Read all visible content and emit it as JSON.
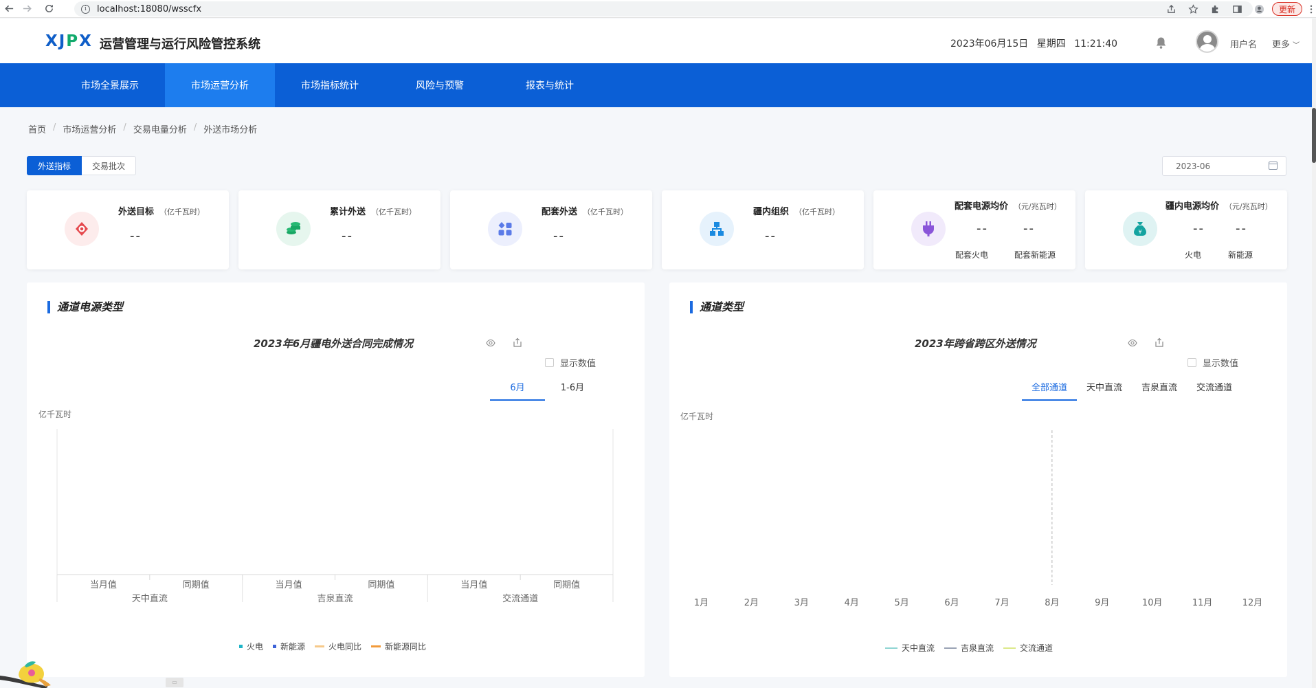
{
  "browser": {
    "url": "localhost:18080/wsscfx",
    "update_label": "更新"
  },
  "header": {
    "logo": "XJPX",
    "system_title": "运营管理与运行风险管控系统",
    "date": "2023年06月15日",
    "weekday": "星期四",
    "time": "11:21:40",
    "username": "用户名",
    "more": "更多"
  },
  "nav": {
    "items": [
      {
        "label": "市场全景展示",
        "active": false
      },
      {
        "label": "市场运营分析",
        "active": true
      },
      {
        "label": "市场指标统计",
        "active": false
      },
      {
        "label": "风险与预警",
        "active": false
      },
      {
        "label": "报表与统计",
        "active": false
      }
    ]
  },
  "breadcrumb": [
    "首页",
    "市场运营分析",
    "交易电量分析",
    "外送市场分析"
  ],
  "tabs": [
    {
      "label": "外送指标",
      "active": true
    },
    {
      "label": "交易批次",
      "active": false
    }
  ],
  "date_picker": {
    "value": "2023-06"
  },
  "kpis": [
    {
      "title": "外送目标",
      "unit": "（亿千瓦时）",
      "value": "--",
      "icon": "target-icon",
      "color": "#e5484d",
      "bg": "#fdecec"
    },
    {
      "title": "累计外送",
      "unit": "（亿千瓦时）",
      "value": "--",
      "icon": "coins-icon",
      "color": "#19a764",
      "bg": "#e6f6ee"
    },
    {
      "title": "配套外送",
      "unit": "（亿千瓦时）",
      "value": "--",
      "icon": "grid-icon",
      "color": "#5b7be8",
      "bg": "#eceffd"
    },
    {
      "title": "疆内组织",
      "unit": "（亿千瓦时）",
      "value": "--",
      "icon": "hierarchy-icon",
      "color": "#1a8ae0",
      "bg": "#e6f2fc"
    },
    {
      "title": "配套电源均价",
      "unit": "（元/兆瓦时）",
      "values": [
        "--",
        "--"
      ],
      "subs": [
        "配套火电",
        "配套新能源"
      ],
      "icon": "plug-icon",
      "color": "#8a55d9",
      "bg": "#f1eafb"
    },
    {
      "title": "疆内电源均价",
      "unit": "（元/兆瓦时）",
      "values": [
        "--",
        "--"
      ],
      "subs": [
        "火电",
        "新能源"
      ],
      "icon": "money-bag-icon",
      "color": "#14a3a0",
      "bg": "#dff3f3"
    }
  ],
  "left_panel": {
    "title": "通道电源类型",
    "chart_title": "2023年6月疆电外送合同完成情况",
    "show_values": "显示数值",
    "tabs": [
      {
        "label": "6月",
        "active": true
      },
      {
        "label": "1-6月",
        "active": false
      }
    ],
    "unit": "亿千瓦时"
  },
  "right_panel": {
    "title": "通道类型",
    "chart_title": "2023年跨省跨区外送情况",
    "show_values": "显示数值",
    "tabs": [
      {
        "label": "全部通道",
        "active": true
      },
      {
        "label": "天中直流",
        "active": false
      },
      {
        "label": "吉泉直流",
        "active": false
      },
      {
        "label": "交流通道",
        "active": false
      }
    ],
    "unit": "亿千瓦时"
  },
  "chart_data": [
    {
      "type": "bar",
      "title": "2023年6月疆电外送合同完成情况",
      "ylabel": "亿千瓦时",
      "groups": [
        "天中直流",
        "吉泉直流",
        "交流通道"
      ],
      "categories": [
        "当月值",
        "同期值",
        "当月值",
        "同期值",
        "当月值",
        "同期值"
      ],
      "series": [
        {
          "name": "火电",
          "values": [],
          "color": "#1fb5c8"
        },
        {
          "name": "新能源",
          "values": [],
          "color": "#3d63d8"
        },
        {
          "name": "火电同比",
          "values": [],
          "color": "#f6c98a"
        },
        {
          "name": "新能源同比",
          "values": [],
          "color": "#f29a3a"
        }
      ]
    },
    {
      "type": "line",
      "title": "2023年跨省跨区外送情况",
      "ylabel": "亿千瓦时",
      "x": [
        "1月",
        "2月",
        "3月",
        "4月",
        "5月",
        "6月",
        "7月",
        "8月",
        "9月",
        "10月",
        "11月",
        "12月"
      ],
      "series": [
        {
          "name": "天中直流",
          "values": [],
          "color": "#8fd5d3"
        },
        {
          "name": "吉泉直流",
          "values": [],
          "color": "#9aa3b5"
        },
        {
          "name": "交流通道",
          "values": [],
          "color": "#dce98a"
        }
      ]
    }
  ]
}
